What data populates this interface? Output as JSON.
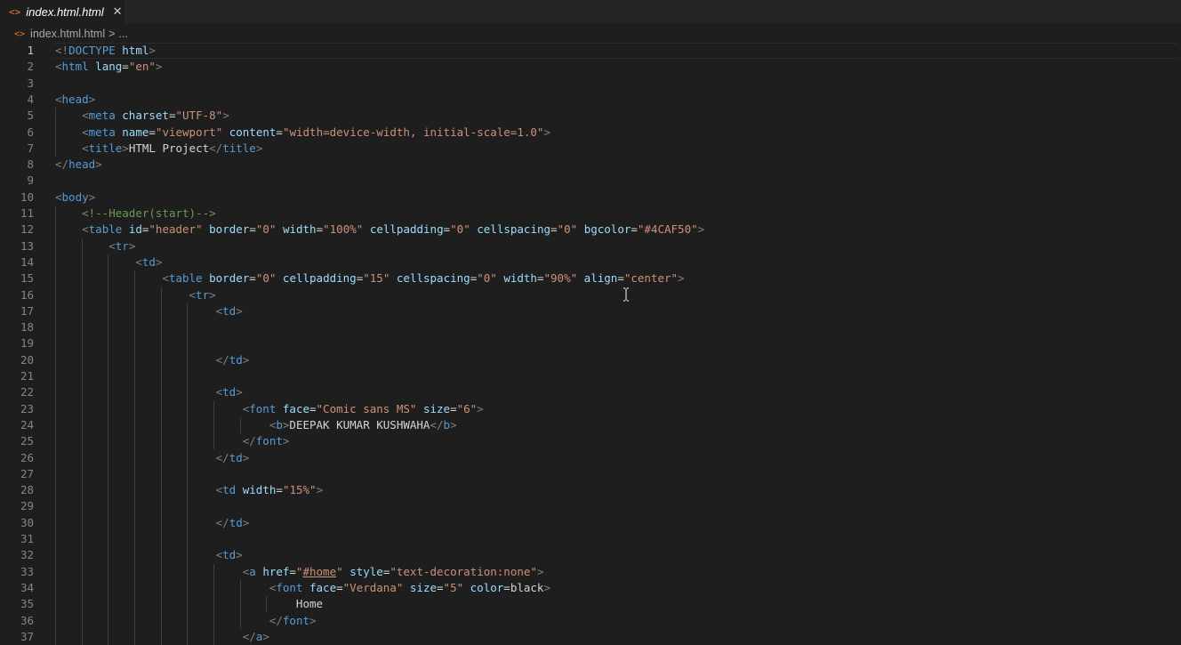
{
  "tab": {
    "label": "index.html.html",
    "icon": "html-file-icon",
    "close": "✕"
  },
  "breadcrumb": {
    "file": "index.html.html",
    "separator": ">",
    "ellipsis": "..."
  },
  "editor": {
    "active_line": 1,
    "lines": [
      {
        "n": "1",
        "tokens": [
          [
            "p",
            "<!"
          ],
          [
            "t",
            "DOCTYPE"
          ],
          [
            "x",
            " "
          ],
          [
            "a",
            "html"
          ],
          [
            "p",
            ">"
          ]
        ]
      },
      {
        "n": "2",
        "tokens": [
          [
            "p",
            "<"
          ],
          [
            "t",
            "html"
          ],
          [
            "x",
            " "
          ],
          [
            "a",
            "lang"
          ],
          [
            "x",
            "="
          ],
          [
            "s",
            "\"en\""
          ],
          [
            "p",
            ">"
          ]
        ]
      },
      {
        "n": "3",
        "tokens": []
      },
      {
        "n": "4",
        "tokens": [
          [
            "p",
            "<"
          ],
          [
            "t",
            "head"
          ],
          [
            "p",
            ">"
          ]
        ]
      },
      {
        "n": "5",
        "tokens": [
          [
            "x",
            "    "
          ],
          [
            "p",
            "<"
          ],
          [
            "t",
            "meta"
          ],
          [
            "x",
            " "
          ],
          [
            "a",
            "charset"
          ],
          [
            "x",
            "="
          ],
          [
            "s",
            "\"UTF-8\""
          ],
          [
            "p",
            ">"
          ]
        ]
      },
      {
        "n": "6",
        "tokens": [
          [
            "x",
            "    "
          ],
          [
            "p",
            "<"
          ],
          [
            "t",
            "meta"
          ],
          [
            "x",
            " "
          ],
          [
            "a",
            "name"
          ],
          [
            "x",
            "="
          ],
          [
            "s",
            "\"viewport\""
          ],
          [
            "x",
            " "
          ],
          [
            "a",
            "content"
          ],
          [
            "x",
            "="
          ],
          [
            "s",
            "\"width=device-width, initial-scale=1.0\""
          ],
          [
            "p",
            ">"
          ]
        ]
      },
      {
        "n": "7",
        "tokens": [
          [
            "x",
            "    "
          ],
          [
            "p",
            "<"
          ],
          [
            "t",
            "title"
          ],
          [
            "p",
            ">"
          ],
          [
            "x",
            "HTML Project"
          ],
          [
            "p",
            "</"
          ],
          [
            "t",
            "title"
          ],
          [
            "p",
            ">"
          ]
        ]
      },
      {
        "n": "8",
        "tokens": [
          [
            "p",
            "</"
          ],
          [
            "t",
            "head"
          ],
          [
            "p",
            ">"
          ]
        ]
      },
      {
        "n": "9",
        "tokens": []
      },
      {
        "n": "10",
        "tokens": [
          [
            "p",
            "<"
          ],
          [
            "t",
            "body"
          ],
          [
            "p",
            ">"
          ]
        ]
      },
      {
        "n": "11",
        "tokens": [
          [
            "x",
            "    "
          ],
          [
            "c",
            "<!--Header(start)-->"
          ]
        ]
      },
      {
        "n": "12",
        "tokens": [
          [
            "x",
            "    "
          ],
          [
            "p",
            "<"
          ],
          [
            "t",
            "table"
          ],
          [
            "x",
            " "
          ],
          [
            "a",
            "id"
          ],
          [
            "x",
            "="
          ],
          [
            "s",
            "\"header\""
          ],
          [
            "x",
            " "
          ],
          [
            "a",
            "border"
          ],
          [
            "x",
            "="
          ],
          [
            "s",
            "\"0\""
          ],
          [
            "x",
            " "
          ],
          [
            "a",
            "width"
          ],
          [
            "x",
            "="
          ],
          [
            "s",
            "\"100%\""
          ],
          [
            "x",
            " "
          ],
          [
            "a",
            "cellpadding"
          ],
          [
            "x",
            "="
          ],
          [
            "s",
            "\"0\""
          ],
          [
            "x",
            " "
          ],
          [
            "a",
            "cellspacing"
          ],
          [
            "x",
            "="
          ],
          [
            "s",
            "\"0\""
          ],
          [
            "x",
            " "
          ],
          [
            "a",
            "bgcolor"
          ],
          [
            "x",
            "="
          ],
          [
            "s",
            "\"#4CAF50\""
          ],
          [
            "p",
            ">"
          ]
        ]
      },
      {
        "n": "13",
        "tokens": [
          [
            "x",
            "        "
          ],
          [
            "p",
            "<"
          ],
          [
            "t",
            "tr"
          ],
          [
            "p",
            ">"
          ]
        ]
      },
      {
        "n": "14",
        "tokens": [
          [
            "x",
            "            "
          ],
          [
            "p",
            "<"
          ],
          [
            "t",
            "td"
          ],
          [
            "p",
            ">"
          ]
        ]
      },
      {
        "n": "15",
        "tokens": [
          [
            "x",
            "                "
          ],
          [
            "p",
            "<"
          ],
          [
            "t",
            "table"
          ],
          [
            "x",
            " "
          ],
          [
            "a",
            "border"
          ],
          [
            "x",
            "="
          ],
          [
            "s",
            "\"0\""
          ],
          [
            "x",
            " "
          ],
          [
            "a",
            "cellpadding"
          ],
          [
            "x",
            "="
          ],
          [
            "s",
            "\"15\""
          ],
          [
            "x",
            " "
          ],
          [
            "a",
            "cellspacing"
          ],
          [
            "x",
            "="
          ],
          [
            "s",
            "\"0\""
          ],
          [
            "x",
            " "
          ],
          [
            "a",
            "width"
          ],
          [
            "x",
            "="
          ],
          [
            "s",
            "\"90%\""
          ],
          [
            "x",
            " "
          ],
          [
            "a",
            "align"
          ],
          [
            "x",
            "="
          ],
          [
            "s",
            "\"center\""
          ],
          [
            "p",
            ">"
          ]
        ]
      },
      {
        "n": "16",
        "tokens": [
          [
            "x",
            "                    "
          ],
          [
            "p",
            "<"
          ],
          [
            "t",
            "tr"
          ],
          [
            "p",
            ">"
          ]
        ]
      },
      {
        "n": "17",
        "tokens": [
          [
            "x",
            "                        "
          ],
          [
            "p",
            "<"
          ],
          [
            "t",
            "td"
          ],
          [
            "p",
            ">"
          ]
        ]
      },
      {
        "n": "18",
        "tokens": []
      },
      {
        "n": "19",
        "tokens": []
      },
      {
        "n": "20",
        "tokens": [
          [
            "x",
            "                        "
          ],
          [
            "p",
            "</"
          ],
          [
            "t",
            "td"
          ],
          [
            "p",
            ">"
          ]
        ]
      },
      {
        "n": "21",
        "tokens": []
      },
      {
        "n": "22",
        "tokens": [
          [
            "x",
            "                        "
          ],
          [
            "p",
            "<"
          ],
          [
            "t",
            "td"
          ],
          [
            "p",
            ">"
          ]
        ]
      },
      {
        "n": "23",
        "tokens": [
          [
            "x",
            "                            "
          ],
          [
            "p",
            "<"
          ],
          [
            "t",
            "font"
          ],
          [
            "x",
            " "
          ],
          [
            "a",
            "face"
          ],
          [
            "x",
            "="
          ],
          [
            "s",
            "\"Comic sans MS\""
          ],
          [
            "x",
            " "
          ],
          [
            "a",
            "size"
          ],
          [
            "x",
            "="
          ],
          [
            "s",
            "\"6\""
          ],
          [
            "p",
            ">"
          ]
        ]
      },
      {
        "n": "24",
        "tokens": [
          [
            "x",
            "                                "
          ],
          [
            "p",
            "<"
          ],
          [
            "t",
            "b"
          ],
          [
            "p",
            ">"
          ],
          [
            "x",
            "DEEPAK KUMAR KUSHWAHA"
          ],
          [
            "p",
            "</"
          ],
          [
            "t",
            "b"
          ],
          [
            "p",
            ">"
          ]
        ]
      },
      {
        "n": "25",
        "tokens": [
          [
            "x",
            "                            "
          ],
          [
            "p",
            "</"
          ],
          [
            "t",
            "font"
          ],
          [
            "p",
            ">"
          ]
        ]
      },
      {
        "n": "26",
        "tokens": [
          [
            "x",
            "                        "
          ],
          [
            "p",
            "</"
          ],
          [
            "t",
            "td"
          ],
          [
            "p",
            ">"
          ]
        ]
      },
      {
        "n": "27",
        "tokens": []
      },
      {
        "n": "28",
        "tokens": [
          [
            "x",
            "                        "
          ],
          [
            "p",
            "<"
          ],
          [
            "t",
            "td"
          ],
          [
            "x",
            " "
          ],
          [
            "a",
            "width"
          ],
          [
            "x",
            "="
          ],
          [
            "s",
            "\"15%\""
          ],
          [
            "p",
            ">"
          ]
        ]
      },
      {
        "n": "29",
        "tokens": []
      },
      {
        "n": "30",
        "tokens": [
          [
            "x",
            "                        "
          ],
          [
            "p",
            "</"
          ],
          [
            "t",
            "td"
          ],
          [
            "p",
            ">"
          ]
        ]
      },
      {
        "n": "31",
        "tokens": []
      },
      {
        "n": "32",
        "tokens": [
          [
            "x",
            "                        "
          ],
          [
            "p",
            "<"
          ],
          [
            "t",
            "td"
          ],
          [
            "p",
            ">"
          ]
        ]
      },
      {
        "n": "33",
        "tokens": [
          [
            "x",
            "                            "
          ],
          [
            "p",
            "<"
          ],
          [
            "t",
            "a"
          ],
          [
            "x",
            " "
          ],
          [
            "a",
            "href"
          ],
          [
            "x",
            "="
          ],
          [
            "s",
            "\""
          ],
          [
            "su",
            "#home"
          ],
          [
            "s",
            "\""
          ],
          [
            "x",
            " "
          ],
          [
            "a",
            "style"
          ],
          [
            "x",
            "="
          ],
          [
            "s",
            "\"text-decoration:none\""
          ],
          [
            "p",
            ">"
          ]
        ]
      },
      {
        "n": "34",
        "tokens": [
          [
            "x",
            "                                "
          ],
          [
            "p",
            "<"
          ],
          [
            "t",
            "font"
          ],
          [
            "x",
            " "
          ],
          [
            "a",
            "face"
          ],
          [
            "x",
            "="
          ],
          [
            "s",
            "\"Verdana\""
          ],
          [
            "x",
            " "
          ],
          [
            "a",
            "size"
          ],
          [
            "x",
            "="
          ],
          [
            "s",
            "\"5\""
          ],
          [
            "x",
            " "
          ],
          [
            "a",
            "color"
          ],
          [
            "x",
            "="
          ],
          [
            "x",
            "black"
          ],
          [
            "p",
            ">"
          ]
        ]
      },
      {
        "n": "35",
        "tokens": [
          [
            "x",
            "                                    Home"
          ]
        ]
      },
      {
        "n": "36",
        "tokens": [
          [
            "x",
            "                                "
          ],
          [
            "p",
            "</"
          ],
          [
            "t",
            "font"
          ],
          [
            "p",
            ">"
          ]
        ]
      },
      {
        "n": "37",
        "tokens": [
          [
            "x",
            "                            "
          ],
          [
            "p",
            "</"
          ],
          [
            "t",
            "a"
          ],
          [
            "p",
            ">"
          ]
        ]
      }
    ]
  },
  "colors": {
    "background": "#1e1e1e",
    "tag": "#569cd6",
    "attribute": "#9cdcfe",
    "string": "#ce9178",
    "comment": "#6a9955",
    "punctuation": "#808080",
    "html_icon": "#e37933"
  }
}
